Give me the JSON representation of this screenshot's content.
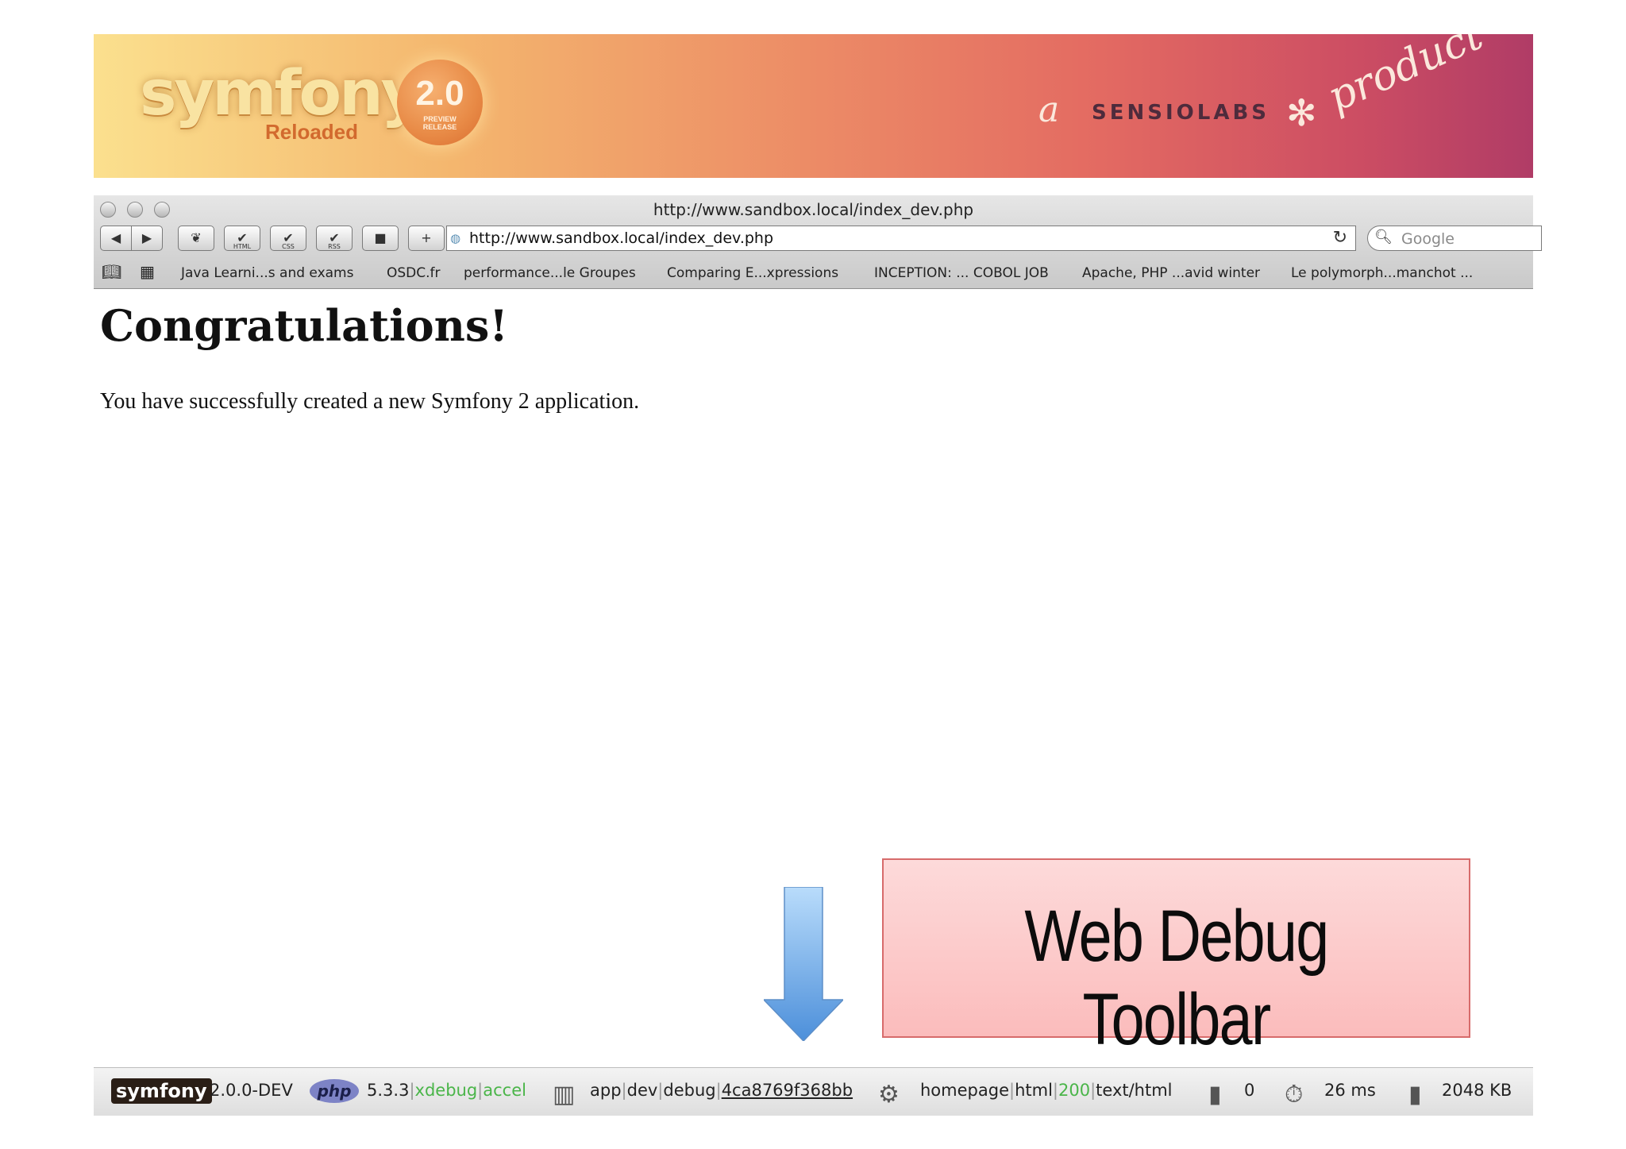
{
  "banner": {
    "logo_word": "symfony",
    "logo_sub": "Reloaded",
    "badge_version": "2.0",
    "badge_line1": "PREVIEW",
    "badge_line2": "RELEASE",
    "tag_a": "a",
    "tag_company": "SENSIOLABS",
    "tag_product": "product",
    "gradient_colors": [
      "#fbe08e",
      "#ec8b66",
      "#b03c66"
    ]
  },
  "browser": {
    "window_title": "http://www.sandbox.local/index_dev.php",
    "url": "http://www.sandbox.local/index_dev.php",
    "search_placeholder": "Google",
    "toolbar_buttons": [
      {
        "name": "back-button",
        "glyph": "◀"
      },
      {
        "name": "forward-button",
        "glyph": "▶"
      },
      {
        "name": "leaf-button",
        "glyph": "❦"
      },
      {
        "name": "html-validate-button",
        "glyph": "✔",
        "label": "HTML"
      },
      {
        "name": "css-validate-button",
        "glyph": "✔",
        "label": "CSS"
      },
      {
        "name": "rss-validate-button",
        "glyph": "✔",
        "label": "RSS"
      },
      {
        "name": "screen-button",
        "glyph": "■"
      },
      {
        "name": "add-bookmark-button",
        "glyph": "+"
      }
    ],
    "bookmarks": [
      "Java Learni...s and exams",
      "OSDC.fr",
      "performance...le Groupes",
      "Comparing E...xpressions",
      "INCEPTION: ... COBOL JOB",
      "Apache, PHP ...avid winter",
      "Le polymorph...manchot ..."
    ]
  },
  "page": {
    "title": "Congratulations!",
    "text": "You have successfully created a new Symfony 2 application."
  },
  "annotation": {
    "label": "Web Debug Toolbar",
    "arrow_color": "#6fa9e6"
  },
  "debug_toolbar": {
    "logo": "symfony",
    "symfony_version": "2.0.0-DEV",
    "php_logo": "php",
    "php_version": "5.3.3",
    "ext_xdebug": "xdebug",
    "ext_accel": "accel",
    "app_name": "app",
    "environment": "dev",
    "debug_label": "debug",
    "token": "4ca8769f368bb",
    "route": "homepage",
    "format": "html",
    "status_code": "200",
    "content_type": "text/html",
    "db_queries": "0",
    "time": "26 ms",
    "memory": "2048 KB"
  }
}
